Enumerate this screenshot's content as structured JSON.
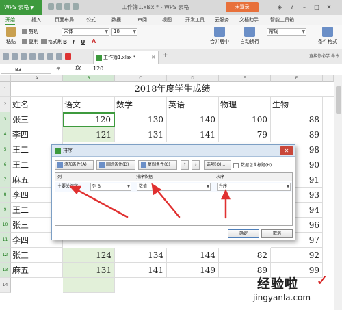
{
  "app": {
    "brand": "WPS 表格",
    "document_title": "工作簿1.xlsx * - WPS 表格",
    "login_label": "未登录"
  },
  "ribbon": {
    "tabs": [
      "开始",
      "插入",
      "页面布局",
      "公式",
      "数据",
      "审阅",
      "视图",
      "开发工具",
      "云服务",
      "文档助手",
      "智能工具箱"
    ],
    "active_tab": "开始"
  },
  "toolbar": {
    "paste": "粘贴",
    "cut": "剪切",
    "copy": "复制",
    "format_painter": "格式刷",
    "font_name": "宋体",
    "font_size": "18",
    "merge_center": "合并居中",
    "wrap_text": "自动换行",
    "number_format": "常规",
    "conditional_format": "条件格式"
  },
  "file_tab": {
    "name": "工作簿1.xlsx *"
  },
  "tabrow_right": "直接你必学 命令",
  "formula_bar": {
    "cell_ref": "B3",
    "fx": "fx",
    "value": "120"
  },
  "columns": [
    "A",
    "B",
    "C",
    "D",
    "E",
    "F"
  ],
  "rows": [
    "1",
    "2",
    "3",
    "4",
    "5",
    "6",
    "7",
    "8",
    "9",
    "10",
    "11",
    "12",
    "13",
    "14"
  ],
  "sheet": {
    "title": "2018年度学生成绩",
    "headers": [
      "姓名",
      "语文",
      "数学",
      "英语",
      "物理",
      "生物"
    ],
    "data": [
      [
        "张三",
        "120",
        "130",
        "140",
        "100",
        "88"
      ],
      [
        "李四",
        "121",
        "131",
        "141",
        "79",
        "89"
      ],
      [
        "王二",
        "",
        "",
        "",
        "",
        "98"
      ],
      [
        "王二",
        "",
        "",
        "",
        "",
        "90"
      ],
      [
        "麻五",
        "",
        "",
        "",
        "",
        "91"
      ],
      [
        "李四",
        "",
        "",
        "",
        "",
        "93"
      ],
      [
        "王二",
        "",
        "",
        "",
        "",
        "94"
      ],
      [
        "张三",
        "",
        "",
        "",
        "",
        "96"
      ],
      [
        "李四",
        "",
        "",
        "",
        "",
        "97"
      ],
      [
        "张三",
        "124",
        "134",
        "144",
        "82",
        "92"
      ],
      [
        "麻五",
        "131",
        "141",
        "149",
        "89",
        "99"
      ]
    ]
  },
  "sort_dialog": {
    "title": "排序",
    "add_condition": "添加条件(A)",
    "delete_condition": "删除条件(D)",
    "copy_condition": "复制条件(C)",
    "up": "↑",
    "down": "↓",
    "options": "选项(O)...",
    "has_header_label": "数据包含标题(H)",
    "col_header": "列",
    "sort_on_header": "排序依据",
    "order_header": "次序",
    "primary_key_label": "主要关键字",
    "column_value": "列 B",
    "sort_on_value": "数值",
    "order_value": "升序",
    "ok": "确定",
    "cancel": "取消"
  },
  "watermark": {
    "cn": "经验啦",
    "check": "✓",
    "url": "jingyanla.com"
  },
  "colors": {
    "brand_green": "#3d9a3d",
    "selection_fill": "#e2f0d9",
    "annotation_red": "#e03030",
    "login_orange": "#e8703a"
  }
}
